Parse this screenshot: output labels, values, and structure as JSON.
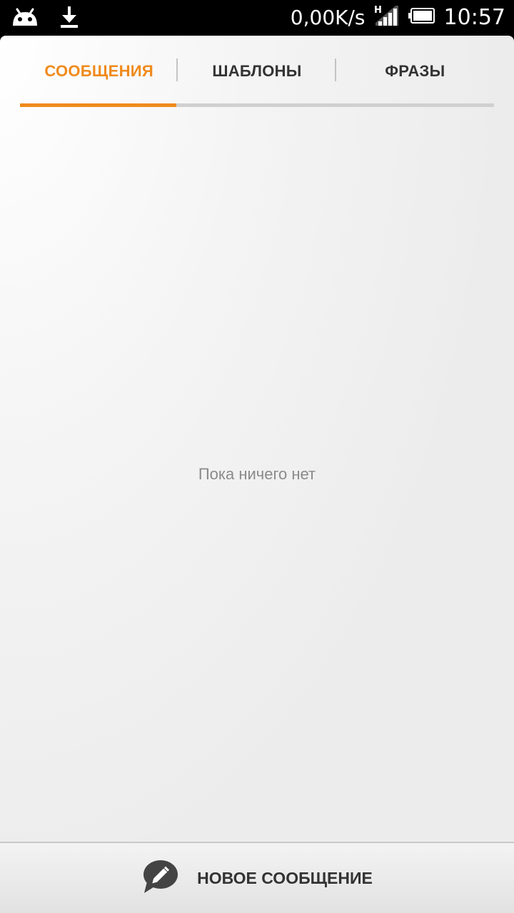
{
  "status_bar": {
    "left_icons": [
      "android-icon",
      "download-icon"
    ],
    "network_speed": "0,00K/s",
    "network_type": "H",
    "signal_icon": "signal-icon",
    "battery_icon": "battery-icon",
    "time": "10:57"
  },
  "tabs": [
    {
      "label": "СООБЩЕНИЯ",
      "active": true
    },
    {
      "label": "ШАБЛОНЫ",
      "active": false
    },
    {
      "label": "ФРАЗЫ",
      "active": false
    }
  ],
  "empty_state": {
    "message": "Пока ничего нет"
  },
  "bottom_action": {
    "icon": "compose-bubble-icon",
    "label": "НОВОЕ СООБЩЕНИЕ"
  },
  "colors": {
    "accent": "#f08a1c",
    "tab_text": "#333333",
    "empty_text": "#8a8a8a"
  }
}
